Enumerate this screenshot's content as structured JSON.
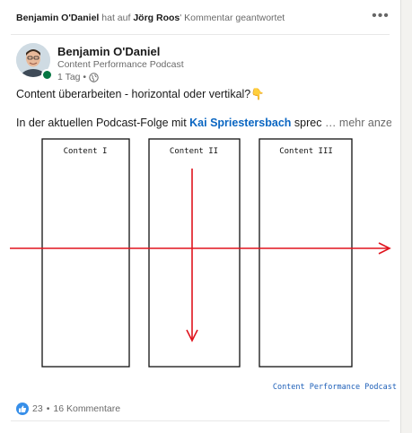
{
  "context": {
    "actor": "Benjamin O'Daniel",
    "middle": "hat auf",
    "target": "Jörg Roos",
    "action": "' Kommentar geantwortet"
  },
  "author": {
    "name": "Benjamin O'Daniel",
    "headline": "Content Performance Podcast",
    "time": "1 Tag •"
  },
  "post": {
    "title": "Content überarbeiten - horizontal oder vertikal?👇",
    "body_before": "In der aktuellen Podcast-Folge mit ",
    "mention": "Kai Spriestersbach",
    "body_after": " sprec",
    "see_more": "… mehr anzeigen"
  },
  "image": {
    "col1": "Content I",
    "col2": "Content II",
    "col3": "Content III",
    "watermark": "Content Performance Podcast",
    "arrow_color": "#e0141e",
    "watermark_color": "#1d5fb8"
  },
  "social": {
    "reactions": "23",
    "separator": "•",
    "comments": "16 Kommentare"
  }
}
